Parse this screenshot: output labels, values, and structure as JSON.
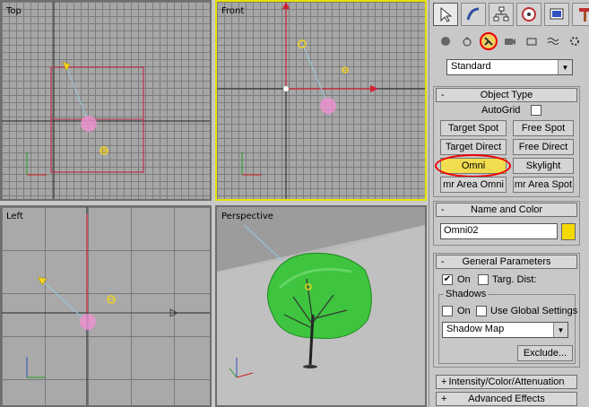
{
  "viewports": {
    "top": "Top",
    "front": "Front",
    "left": "Left",
    "perspective": "Perspective"
  },
  "tabs": [
    "create-icon",
    "modify-icon",
    "hierarchy-icon",
    "motion-icon",
    "display-icon",
    "utilities-icon"
  ],
  "categories": [
    "geometry-icon",
    "shapes-icon",
    "lights-icon",
    "cameras-icon",
    "helpers-icon",
    "spacewarps-icon",
    "systems-icon"
  ],
  "subtype": "Standard",
  "object_type": {
    "title": "Object Type",
    "sign": "-",
    "autogrid": "AutoGrid",
    "buttons": [
      "Target Spot",
      "Free Spot",
      "Target Direct",
      "Free Direct",
      "Omni",
      "Skylight",
      "mr Area Omni",
      "mr Area Spot"
    ]
  },
  "name_color": {
    "title": "Name and Color",
    "sign": "-",
    "name": "Omni02",
    "color": "#f5d800"
  },
  "general": {
    "title": "General Parameters",
    "sign": "-",
    "on": "On",
    "targ_dist": "Targ. Dist:",
    "shadows": "Shadows",
    "shadow_on": "On",
    "use_global": "Use Global Settings",
    "shadow_type": "Shadow Map",
    "exclude": "Exclude..."
  },
  "rollouts_collapsed": [
    {
      "sign": "+",
      "title": "Intensity/Color/Attenuation"
    },
    {
      "sign": "+",
      "title": "Advanced Effects"
    }
  ]
}
